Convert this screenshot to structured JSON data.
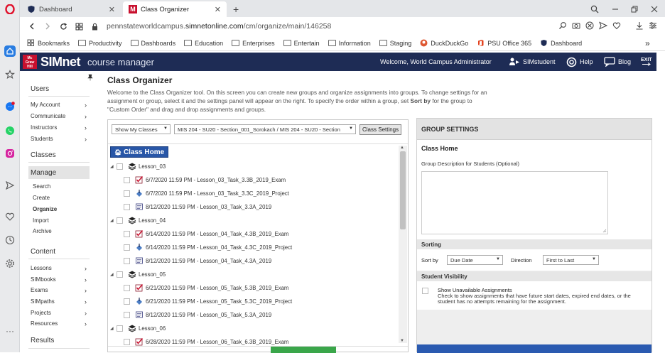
{
  "browser": {
    "tabs": [
      {
        "title": "Dashboard"
      },
      {
        "title": "Class Organizer"
      }
    ],
    "new_tab_symbol": "+",
    "url_host": "pennstateworldcampus.",
    "url_domain": "simnetonline.com",
    "url_path": "/cm/organize/main/146258",
    "bookmarks": [
      {
        "label": "Bookmarks",
        "icon": "star-list-icon"
      },
      {
        "label": "Productivity",
        "icon": "folder-icon"
      },
      {
        "label": "Dashboards",
        "icon": "folder-icon"
      },
      {
        "label": "Education",
        "icon": "folder-icon"
      },
      {
        "label": "Enterprises",
        "icon": "folder-icon"
      },
      {
        "label": "Entertain",
        "icon": "folder-icon"
      },
      {
        "label": "Information",
        "icon": "folder-icon"
      },
      {
        "label": "Staging",
        "icon": "folder-icon"
      },
      {
        "label": "DuckDuckGo",
        "icon": "duckduckgo-icon"
      },
      {
        "label": "PSU Office 365",
        "icon": "office-icon"
      },
      {
        "label": "Dashboard",
        "icon": "shield-icon"
      }
    ],
    "more_bookmarks": "»"
  },
  "header": {
    "brand_small": "Mc Graw Hill",
    "brand": "SIMnet",
    "product": "course manager",
    "welcome": "Welcome, World Campus Administrator",
    "simstudent": "SIMstudent",
    "help": "Help",
    "blog": "Blog",
    "exit": "EXIT"
  },
  "nav": {
    "users_title": "Users",
    "users_items": [
      "My Account",
      "Communicate",
      "Instructors",
      "Students"
    ],
    "classes_title": "Classes",
    "manage_title": "Manage",
    "manage_items": [
      "Search",
      "Create",
      "Organize",
      "Import",
      "Archive"
    ],
    "content_title": "Content",
    "content_items": [
      "Lessons",
      "SIMbooks",
      "Exams",
      "SIMpaths",
      "Projects",
      "Resources"
    ],
    "results_title": "Results"
  },
  "page": {
    "title": "Class Organizer",
    "intro_1": "Welcome to the Class Organizer tool. On this screen you can create new groups and organize assignments into groups. To change settings for an assignment or group, select it and the settings panel will appear on the right. To specify the order within a group, set ",
    "intro_bold": "Sort by",
    "intro_2": " for the group to \"Custom Order\" and drag and drop assignments and groups."
  },
  "tree": {
    "filter_select": "Show My Classes",
    "class_select": "MIS 204 - SU20 - Section_001_Sorokach / MIS 204 - SU20 - Section",
    "class_settings_btn": "Class Settings",
    "class_home": "Class Home",
    "groups": [
      {
        "name": "Lesson_03",
        "items": [
          {
            "type": "exam",
            "label": "6/7/2020 11:59 PM - Lesson_03_Task_3.3B_2019_Exam"
          },
          {
            "type": "project",
            "label": "6/7/2020 11:59 PM - Lesson_03_Task_3.3C_2019_Project"
          },
          {
            "type": "lesson",
            "label": "8/12/2020 11:59 PM - Lesson_03_Task_3.3A_2019"
          }
        ]
      },
      {
        "name": "Lesson_04",
        "items": [
          {
            "type": "exam",
            "label": "6/14/2020 11:59 PM - Lesson_04_Task_4.3B_2019_Exam"
          },
          {
            "type": "project",
            "label": "6/14/2020 11:59 PM - Lesson_04_Task_4.3C_2019_Project"
          },
          {
            "type": "lesson",
            "label": "8/12/2020 11:59 PM - Lesson_04_Task_4.3A_2019"
          }
        ]
      },
      {
        "name": "Lesson_05",
        "items": [
          {
            "type": "exam",
            "label": "6/21/2020 11:59 PM - Lesson_05_Task_5.3B_2019_Exam"
          },
          {
            "type": "project",
            "label": "6/21/2020 11:59 PM - Lesson_05_Task_5.3C_2019_Project"
          },
          {
            "type": "lesson",
            "label": "8/12/2020 11:59 PM - Lesson_05_Task_5.3A_2019"
          }
        ]
      },
      {
        "name": "Lesson_06",
        "items": [
          {
            "type": "exam",
            "label": "6/28/2020 11:59 PM - Lesson_06_Task_6.3B_2019_Exam"
          }
        ]
      }
    ]
  },
  "group_settings": {
    "header": "GROUP SETTINGS",
    "name": "Class Home",
    "desc_label": "Group Description for Students (Optional)",
    "sorting_title": "Sorting",
    "sort_by_label": "Sort by",
    "sort_by_value": "Due Date",
    "direction_label": "Direction",
    "direction_value": "First to Last",
    "visibility_title": "Student Visibility",
    "show_unavailable": "Show Unavailable Assignments",
    "show_unavailable_desc": "Check to show assignments that have future start dates, expired end dates, or the student has no attempts remaining for the assignment."
  },
  "colors": {
    "header_bg": "#1e2c55",
    "class_home_bg": "#2856a7",
    "brand_red": "#c8102e"
  }
}
